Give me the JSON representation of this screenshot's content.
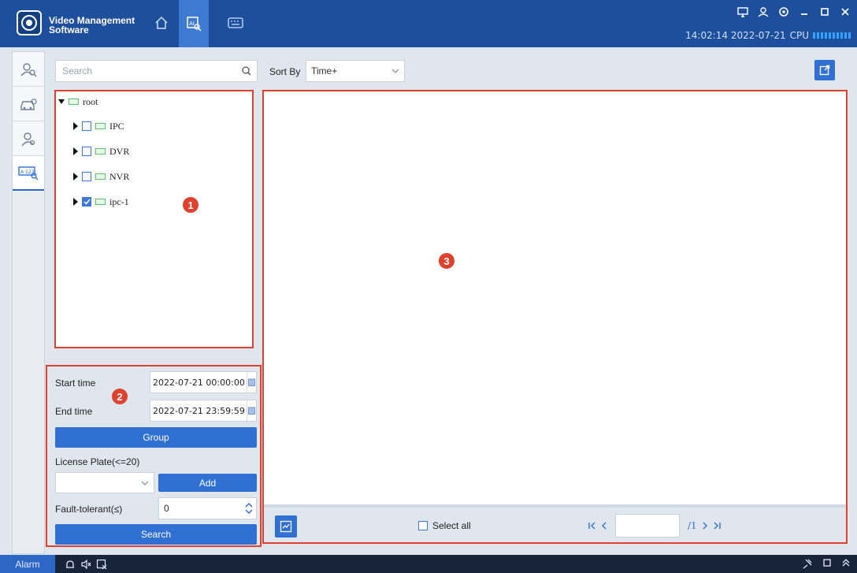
{
  "app": {
    "title_line1": "Video Management",
    "title_line2": "Software",
    "status_time": "14:02:14 2022-07-21",
    "cpu_label": "CPU"
  },
  "nav_tabs": [
    {
      "icon": "home-icon"
    },
    {
      "icon": "ai-search-icon",
      "active": true
    },
    {
      "icon": "keyboard-icon"
    }
  ],
  "window_controls": [
    "monitor-icon",
    "user-icon",
    "settings-icon",
    "minimize-icon",
    "restore-icon",
    "close-icon"
  ],
  "rail": [
    "face-search-icon",
    "vehicle-icon",
    "person-icon",
    "license-plate-icon"
  ],
  "search": {
    "placeholder": "Search"
  },
  "tree": {
    "root": "root",
    "items": [
      {
        "label": "IPC",
        "checked": false
      },
      {
        "label": "DVR",
        "checked": false
      },
      {
        "label": "NVR",
        "checked": false
      },
      {
        "label": "ipc-1",
        "checked": true
      }
    ]
  },
  "badges": {
    "one": "1",
    "two": "2",
    "three": "3"
  },
  "filter": {
    "start_label": "Start time",
    "start_value": "2022-07-21 00:00:00",
    "end_label": "End time",
    "end_value": "2022-07-21 23:59:59",
    "group_button": "Group",
    "plate_label": "License Plate(<=20)",
    "plate_value": "",
    "add_button": "Add",
    "fault_label": "Fault-tolerant(≤)",
    "fault_value": "0",
    "search_button": "Search"
  },
  "sort": {
    "label": "Sort By",
    "value": "Time+"
  },
  "results": {
    "select_all": "Select all",
    "page_input": "",
    "page_total": "/1"
  },
  "bottom": {
    "alarm": "Alarm"
  },
  "colors": {
    "titlebar": "#1e4f9c",
    "accent": "#3170d3",
    "highlight": "#e0402e"
  }
}
